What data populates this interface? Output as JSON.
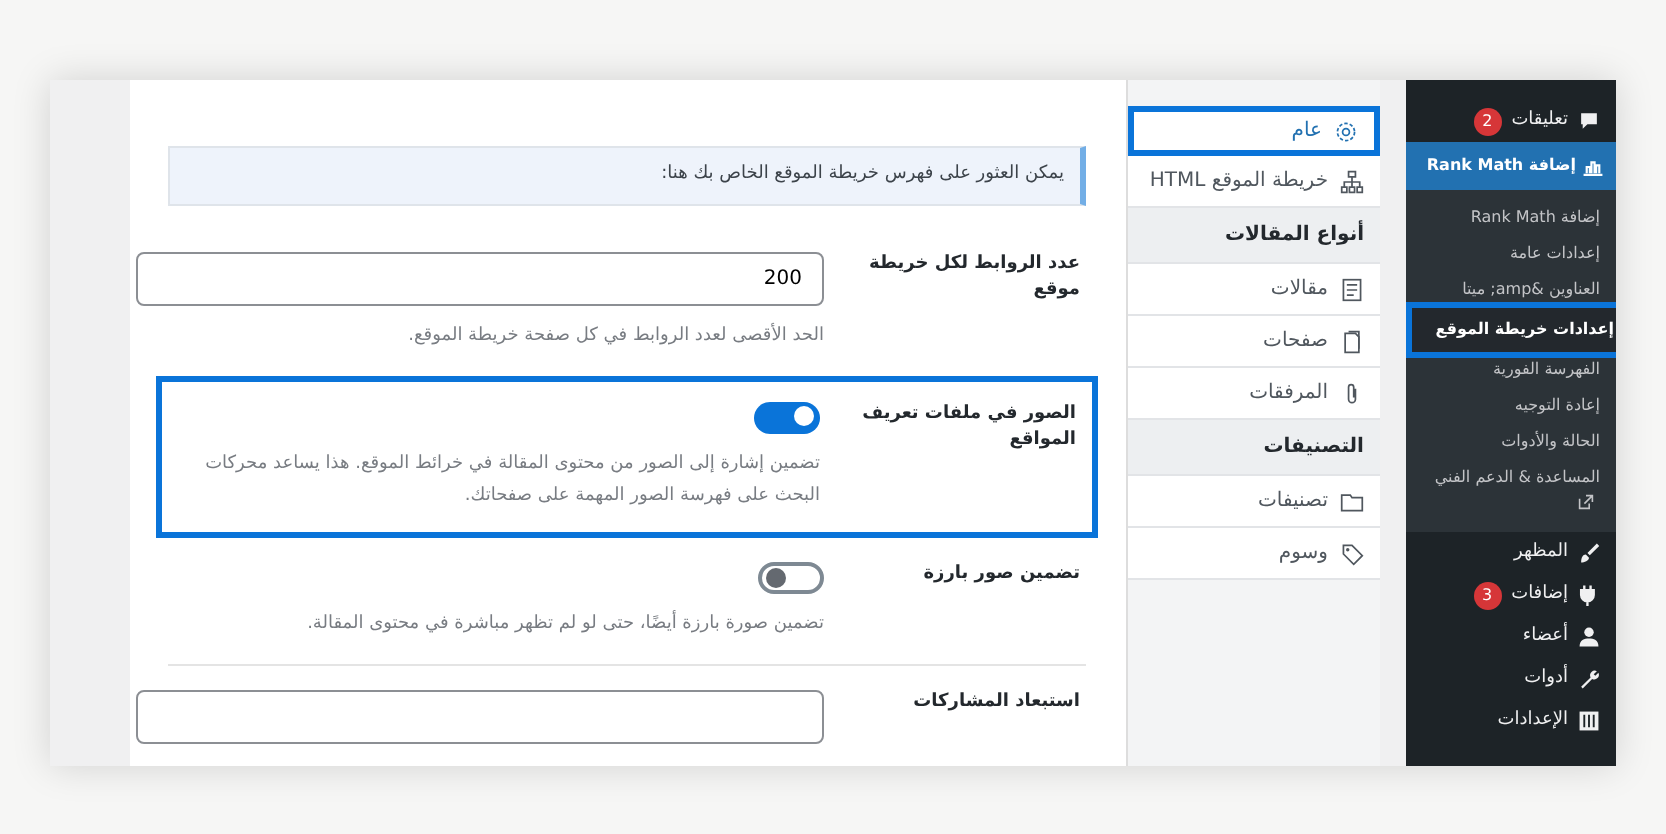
{
  "admin_menu": {
    "items": [
      {
        "label": "تعليقات",
        "badge": "2",
        "active": false
      },
      {
        "label": "إضافة Rank Math",
        "active": true,
        "children": [
          {
            "label": "إضافة Rank Math",
            "selected": false
          },
          {
            "label": "إعدادات عامة",
            "selected": false
          },
          {
            "label": "العناوين &amp; ميتا",
            "selected": false
          },
          {
            "label": "إعدادات خريطة الموقع",
            "selected": true
          },
          {
            "label": "الفهرسة الفورية",
            "selected": false
          },
          {
            "label": "إعادة التوجيه",
            "selected": false
          },
          {
            "label": "الحالة والأدوات",
            "selected": false
          },
          {
            "label": "المساعدة & الدعم الفني",
            "selected": false,
            "external": true
          }
        ]
      },
      {
        "label": "المظهر",
        "active": false
      },
      {
        "label": "إضافات",
        "badge": "3",
        "active": false
      },
      {
        "label": "أعضاء",
        "active": false
      },
      {
        "label": "أدوات",
        "active": false
      },
      {
        "label": "الإعدادات",
        "active": false
      }
    ]
  },
  "tabs": [
    {
      "kind": "tab",
      "label": "عام",
      "selected": true
    },
    {
      "kind": "tab",
      "label": "خريطة الموقع HTML",
      "selected": false
    },
    {
      "kind": "header",
      "label": "أنواع المقالات"
    },
    {
      "kind": "tab",
      "label": "مقالات",
      "selected": false
    },
    {
      "kind": "tab",
      "label": "صفحات",
      "selected": false
    },
    {
      "kind": "tab",
      "label": "المرفقات",
      "selected": false
    },
    {
      "kind": "header",
      "label": "التصنيفات"
    },
    {
      "kind": "tab",
      "label": "تصنيفات",
      "selected": false
    },
    {
      "kind": "tab",
      "label": "وسوم",
      "selected": false
    }
  ],
  "notice": "يمكن العثور على فهرس خريطة الموقع الخاص بك هنا:",
  "settings": [
    {
      "kind": "field",
      "label": "عدد الروابط لكل خريطة موقع",
      "value": "200",
      "description": "الحد الأقصى لعدد الروابط في كل صفحة خريطة الموقع.",
      "highlighted": false
    },
    {
      "kind": "toggle",
      "label": "الصور في ملفات تعريف المواقع",
      "on": true,
      "description": "تضمين إشارة إلى الصور من محتوى المقالة في خرائط الموقع. هذا يساعد محركات البحث على فهرسة الصور المهمة على صفحاتك.",
      "highlighted": true
    },
    {
      "kind": "toggle",
      "label": "تضمين صور بارزة",
      "on": false,
      "description": "تضمين صورة بارزة أيضًا، حتى لو لم تظهر مباشرة في محتوى المقالة.",
      "highlighted": false
    },
    {
      "kind": "field",
      "label": "استبعاد المشاركات",
      "highlighted": false
    }
  ]
}
